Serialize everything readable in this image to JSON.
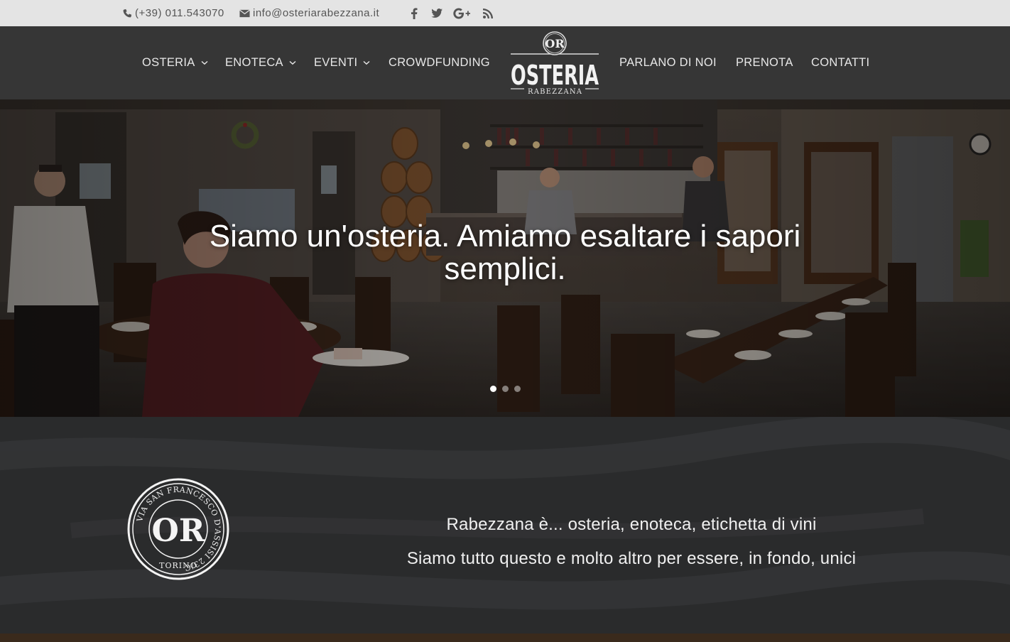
{
  "topbar": {
    "phone": "(+39) 011.543070",
    "email": "info@osteriarabezzana.it",
    "social_icons": [
      "facebook-icon",
      "twitter-icon",
      "google-plus-icon",
      "rss-icon"
    ]
  },
  "nav": {
    "left": [
      {
        "label": "OSTERIA",
        "has_dropdown": true
      },
      {
        "label": "ENOTECA",
        "has_dropdown": true
      },
      {
        "label": "EVENTI",
        "has_dropdown": true
      },
      {
        "label": "CROWDFUNDING",
        "has_dropdown": false
      }
    ],
    "right": [
      {
        "label": "PARLANO DI NOI"
      },
      {
        "label": "PRENOTA"
      },
      {
        "label": "CONTATTI"
      }
    ]
  },
  "logo": {
    "monogram": "OR",
    "name": "OSTERIA",
    "sub": "RABEZZANA"
  },
  "hero": {
    "title": "Siamo un'osteria. Amiamo esaltare i sapori semplici.",
    "slides": 3,
    "active_slide": 1
  },
  "about": {
    "seal": {
      "monogram": "OR",
      "ring_text": "VIA SAN FRANCESCO D'ASSISI 23/C",
      "city": "TORINO"
    },
    "line1": "Rabezzana è... osteria, enoteca, etichetta di vini",
    "line2": "Siamo tutto questo e molto altro per essere, in fondo, unici"
  },
  "colors": {
    "topbar_bg": "#e4e4e4",
    "header_bg": "#363636",
    "board_bg": "#2a2b2c",
    "text_light": "#e8e8e8"
  }
}
